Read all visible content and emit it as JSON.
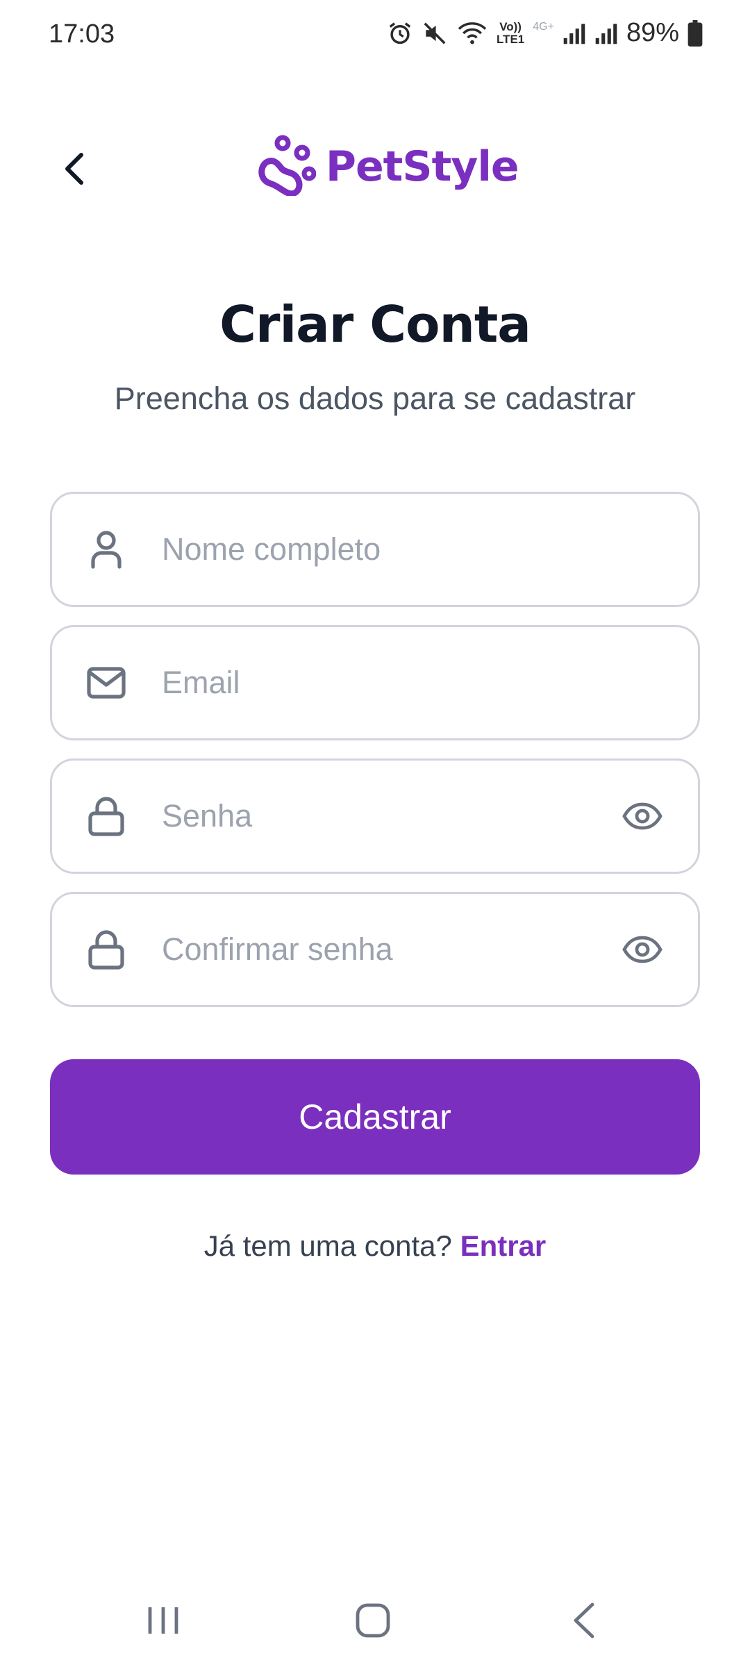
{
  "status_bar": {
    "time": "17:03",
    "battery": "89%",
    "network_labels": [
      "Vo))",
      "LTE1",
      "4G+"
    ],
    "icons": [
      "alarm-icon",
      "mute-icon",
      "wifi-icon",
      "volte-icon",
      "signal-icon",
      "signal-icon",
      "battery-icon"
    ]
  },
  "header": {
    "back_icon": "chevron-left-icon",
    "logo_text": "PetStyle",
    "logo_icon": "paw-icon"
  },
  "title": "Criar Conta",
  "subtitle": "Preencha os dados para se cadastrar",
  "form": {
    "name": {
      "placeholder": "Nome completo",
      "value": "",
      "icon": "user-icon"
    },
    "email": {
      "placeholder": "Email",
      "value": "",
      "icon": "mail-icon"
    },
    "password": {
      "placeholder": "Senha",
      "value": "",
      "icon": "lock-icon",
      "toggle_icon": "eye-icon"
    },
    "confirm_password": {
      "placeholder": "Confirmar senha",
      "value": "",
      "icon": "lock-icon",
      "toggle_icon": "eye-icon"
    }
  },
  "submit_label": "Cadastrar",
  "login_prompt": {
    "text": "Já tem uma conta?",
    "link": "Entrar"
  },
  "nav_bar": {
    "items": [
      "recents-icon",
      "home-icon",
      "back-icon"
    ]
  },
  "colors": {
    "brand": "#7b2fbe",
    "title": "#111827",
    "subtitle": "#4b5563",
    "border": "#d1d5db",
    "placeholder": "#9ca3af",
    "icon": "#6b7280"
  }
}
